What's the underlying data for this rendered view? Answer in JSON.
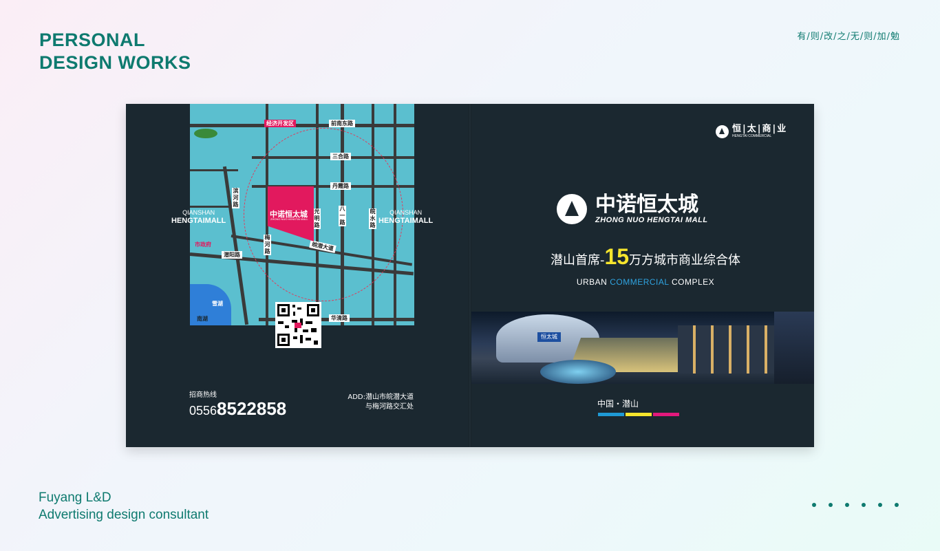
{
  "header": {
    "title_line1": "PERSONAL",
    "title_line2": "DESIGN WORKS",
    "motto": "有/则/改/之/无/则/加/勉"
  },
  "footer": {
    "company": "Fuyang L&D",
    "role": "Advertising design consultant",
    "dots": 6
  },
  "back_cover": {
    "roads": {
      "economic_zone": "经济开发区",
      "qianli_east": "前南东路",
      "sanhe": "三合路",
      "danxia": "丹霞路",
      "wanqian": "皖潜大道",
      "qianyang": "潜阳路",
      "huaqiao": "华清路",
      "bayi": "八一路",
      "guangming": "光明路",
      "meihe": "梅河路",
      "wanshui": "皖水路",
      "binhe": "滨河路"
    },
    "lake": "雪湖",
    "lake2": "南湖",
    "gov": "市政府",
    "site_name": "中诺恒太城",
    "site_sub": "ZHONG NUO HENGTAI MALL",
    "mall_left": {
      "line1": "QIANSHAN",
      "line2": "HENGTAIMALL"
    },
    "mall_right": {
      "line1": "QIANSHAN",
      "line2": "HENGTAIMALL"
    },
    "hotline_label": "招商热线",
    "hotline_area": "0556",
    "hotline_number": "8522858",
    "address_line1": "ADD:潜山市皖潜大道",
    "address_line2": "与梅河路交汇处"
  },
  "front_cover": {
    "brand_name": "恒|太|商|业",
    "brand_sub": "HENGTAI COMMERCIAL",
    "logo_zh": "中诺恒太城",
    "logo_en": "ZHONG NUO HENGTAI MALL",
    "slogan_pre": "潜山首席-",
    "slogan_num": "15",
    "slogan_post": "万方城市商业综合体",
    "sub_a": "URBAN",
    "sub_b": "COMMERCIAL",
    "sub_c": "COMPLEX",
    "sign": "恒太城",
    "place": "中国・潜山",
    "bar_colors": [
      "#1f9ad6",
      "#f6e52d",
      "#e2197c"
    ]
  }
}
